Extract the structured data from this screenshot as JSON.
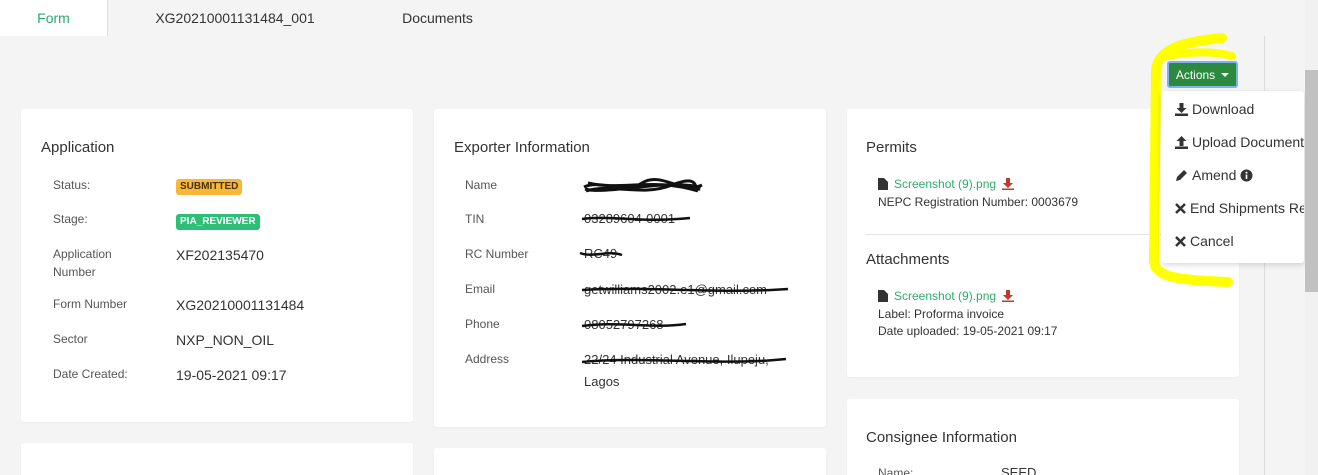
{
  "tabs": [
    {
      "label": "Form",
      "active": true
    },
    {
      "label": "XG20210001131484_001",
      "active": false
    },
    {
      "label": "Documents",
      "active": false
    }
  ],
  "actions": {
    "label": "Actions",
    "menu": [
      {
        "label": "Download",
        "icon": "download-icon"
      },
      {
        "label": "Upload Document",
        "icon": "upload-icon"
      },
      {
        "label": "Amend",
        "icon": "pencil-icon",
        "extra_icon": "info-icon"
      },
      {
        "label": "End Shipments Re",
        "icon": "x-icon"
      },
      {
        "label": "Cancel",
        "icon": "x-icon"
      }
    ]
  },
  "application": {
    "title": "Application",
    "fields": {
      "status_label": "Status:",
      "status_value": "SUBMITTED",
      "stage_label": "Stage:",
      "stage_value": "PIA_REVIEWER",
      "app_number_label_1": "Application",
      "app_number_label_2": "Number",
      "app_number_value": "XF202135470",
      "form_number_label": "Form Number",
      "form_number_value": "XG20210001131484",
      "sector_label": "Sector",
      "sector_value": "NXP_NON_OIL",
      "date_created_label": "Date Created:",
      "date_created_value": "19-05-2021 09:17"
    }
  },
  "exporter": {
    "title": "Exporter Information",
    "fields": {
      "name_label": "Name",
      "tin_label": "TIN",
      "tin_value": "03289604-0001",
      "rc_label": "RC Number",
      "rc_value": "RC49",
      "email_label": "Email",
      "email_value": "getwilliams2002.e1@gmail.com",
      "phone_label": "Phone",
      "phone_value": "08052797268",
      "address_label": "Address",
      "address_value_1": "22/24 Industrial Avenue, Ilupeju,",
      "address_value_2": "Lagos"
    }
  },
  "permits": {
    "title": "Permits",
    "file_name": "Screenshot (9).png",
    "registration": "NEPC Registration Number: 0003679"
  },
  "attachments": {
    "title": "Attachments",
    "file_name": "Screenshot (9).png",
    "label": "Label: Proforma invoice",
    "uploaded": "Date uploaded: 19-05-2021 09:17"
  },
  "consignee": {
    "title": "Consignee Information",
    "name_label": "Name:",
    "name_value": "SEED"
  },
  "colors": {
    "accent_green": "#2ea96f",
    "actions_green": "#2b8a3e",
    "highlight_yellow": "#ffff00",
    "badge_submitted": "#f6b73c",
    "badge_pia": "#2dbf77",
    "download_red": "#c0392b"
  }
}
